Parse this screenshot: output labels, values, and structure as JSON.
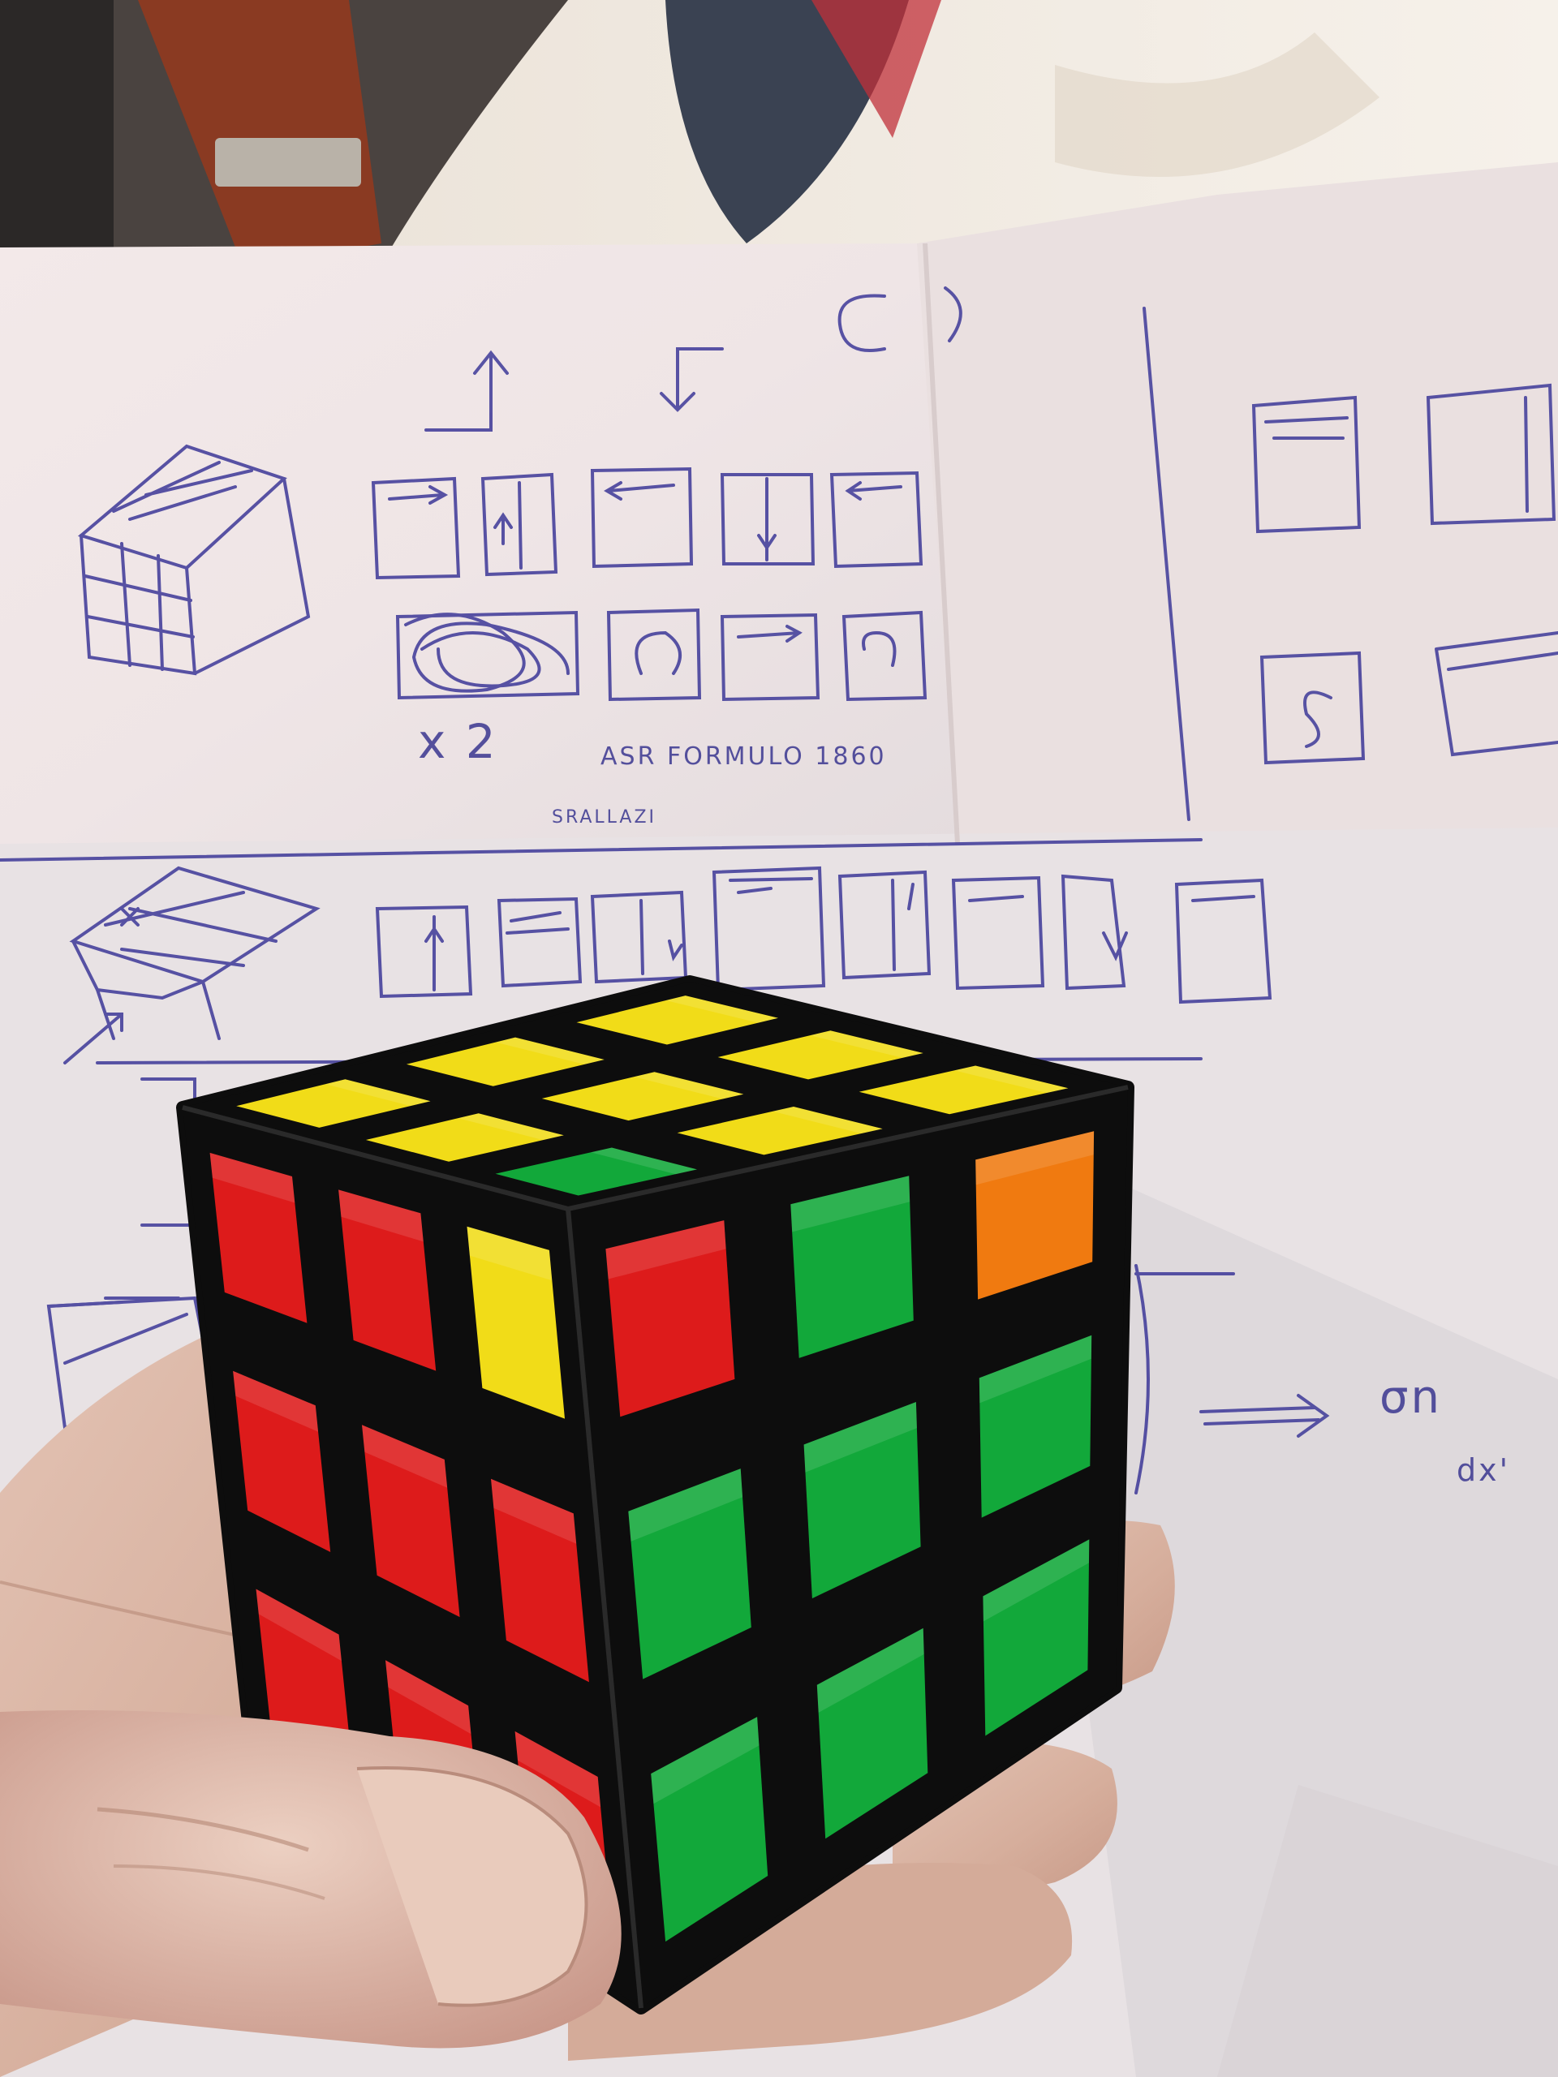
{
  "photo": {
    "subject": "rubiks-cube-held-in-hand",
    "background": "hand-drawn-notation-sheet"
  },
  "notes": {
    "row1_caption": "x 2",
    "row1_words": "ASR  FORMULO  1860",
    "row1_subword": "SRALLAZI",
    "right_mark": "σn",
    "right_sub": "dx'"
  },
  "cube": {
    "top_face": [
      [
        "yellow",
        "yellow",
        "yellow"
      ],
      [
        "yellow",
        "yellow",
        "yellow"
      ],
      [
        "yellow",
        "yellow",
        "green"
      ]
    ],
    "left_face": [
      [
        "red",
        "red",
        "yellow"
      ],
      [
        "red",
        "red",
        "red"
      ],
      [
        "red",
        "red",
        "red"
      ]
    ],
    "right_face": [
      [
        "red",
        "green",
        "orange"
      ],
      [
        "green",
        "green",
        "green"
      ],
      [
        "green",
        "green",
        "green"
      ]
    ],
    "sticker_colors": {
      "yellow": "#f1dc18",
      "green": "#12a83a",
      "red": "#dd1b1b",
      "orange": "#f07a10",
      "body": "#0d0d0d"
    }
  }
}
